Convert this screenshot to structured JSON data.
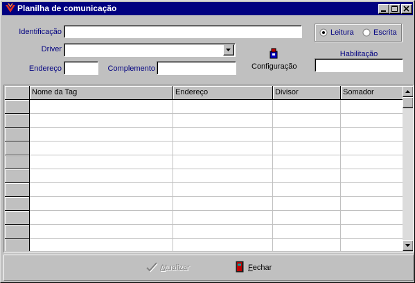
{
  "window": {
    "title": "Planilha de comunicação",
    "icon": "app-logo-icon"
  },
  "form": {
    "identificacao_label": "Identificação",
    "identificacao_value": "",
    "driver_label": "Driver",
    "driver_value": "",
    "endereco_label": "Endereço",
    "endereco_value": "",
    "complemento_label": "Complemento",
    "complemento_value": "",
    "configuracao_label": "Configuração",
    "habilitacao_label": "Habilitação",
    "habilitacao_value": "",
    "mode": {
      "leitura_label": "Leitura",
      "escrita_label": "Escrita",
      "selected": "Leitura"
    }
  },
  "table": {
    "columns": [
      "Nome da Tag",
      "Endereço",
      "Divisor",
      "Somador"
    ],
    "rows": [
      [
        "",
        "",
        "",
        ""
      ],
      [
        "",
        "",
        "",
        ""
      ],
      [
        "",
        "",
        "",
        ""
      ],
      [
        "",
        "",
        "",
        ""
      ],
      [
        "",
        "",
        "",
        ""
      ],
      [
        "",
        "",
        "",
        ""
      ],
      [
        "",
        "",
        "",
        ""
      ],
      [
        "",
        "",
        "",
        ""
      ],
      [
        "",
        "",
        "",
        ""
      ],
      [
        "",
        "",
        "",
        ""
      ],
      [
        "",
        "",
        "",
        ""
      ]
    ]
  },
  "buttons": {
    "atualizar_label": "Atualizar",
    "atualizar_enabled": false,
    "fechar_label": "Fechar"
  },
  "colors": {
    "title_bar": "#000080",
    "label_text": "#000080",
    "face": "#c0c0c0"
  }
}
